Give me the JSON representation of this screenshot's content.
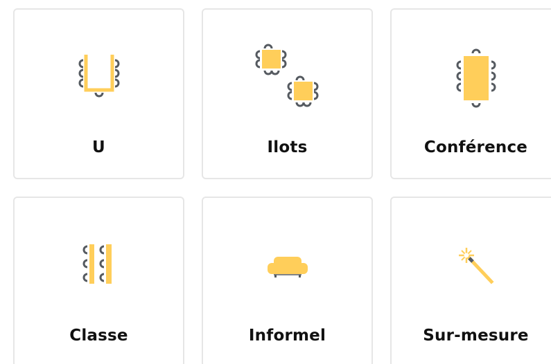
{
  "layouts": [
    {
      "label": "U",
      "icon": "u-shape-table-icon"
    },
    {
      "label": "Ilots",
      "icon": "islands-tables-icon"
    },
    {
      "label": "Conférence",
      "icon": "conference-table-icon"
    },
    {
      "label": "Classe",
      "icon": "classroom-tables-icon"
    },
    {
      "label": "Informel",
      "icon": "sofa-icon"
    },
    {
      "label": "Sur-mesure",
      "icon": "magic-wand-icon"
    }
  ],
  "colors": {
    "accent": "#FFCE5A",
    "chair": "#555a60",
    "border": "#e6e6e6",
    "text": "#111111"
  }
}
